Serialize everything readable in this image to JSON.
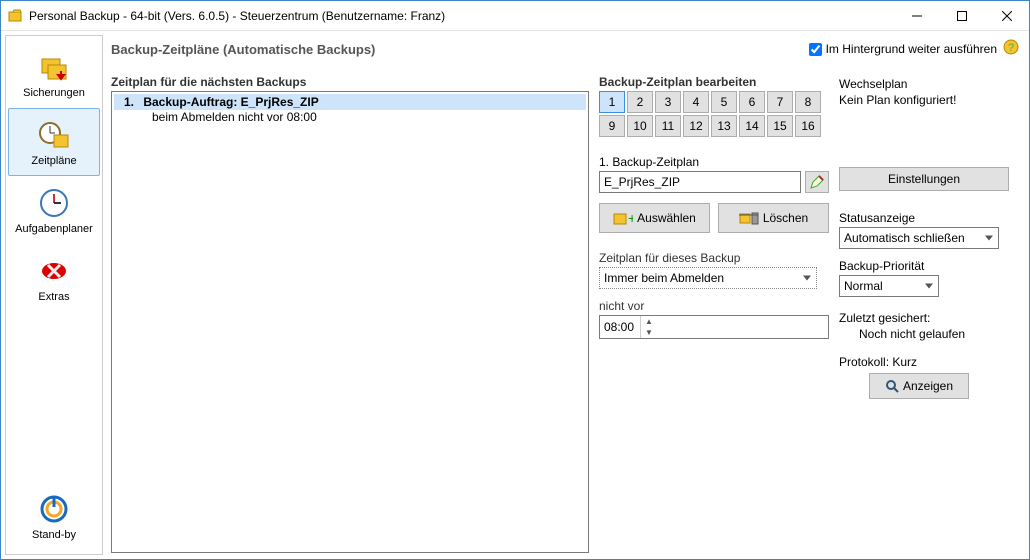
{
  "window": {
    "title": "Personal Backup - 64-bit (Vers. 6.0.5) - Steuerzentrum (Benutzername: Franz)"
  },
  "sidebar": {
    "items": [
      {
        "label": "Sicherungen"
      },
      {
        "label": "Zeitpläne"
      },
      {
        "label": "Aufgabenplaner"
      },
      {
        "label": "Extras"
      },
      {
        "label": "Stand-by"
      }
    ]
  },
  "header": {
    "title": "Backup-Zeitpläne (Automatische Backups)",
    "background_checkbox_label": "Im Hintergrund weiter ausführen",
    "background_checked": true
  },
  "left": {
    "heading": "Zeitplan für die nächsten Backups",
    "list": [
      {
        "idx": "1.",
        "title": "Backup-Auftrag: E_PrjRes_ZIP",
        "sub": "beim Abmelden nicht vor 08:00"
      }
    ]
  },
  "mid": {
    "heading": "Backup-Zeitplan bearbeiten",
    "slots": [
      "1",
      "2",
      "3",
      "4",
      "5",
      "6",
      "7",
      "8",
      "9",
      "10",
      "11",
      "12",
      "13",
      "14",
      "15",
      "16"
    ],
    "selected_slot": 0,
    "plan_prefix": "1.  Backup-Zeitplan",
    "plan_name": "E_PrjRes_ZIP",
    "btn_select": "Auswählen",
    "btn_delete": "Löschen",
    "sched_label": "Zeitplan für dieses Backup",
    "sched_value": "Immer beim Abmelden",
    "notbefore_label": "nicht vor",
    "notbefore_value": "08:00"
  },
  "right": {
    "wp_heading": "Wechselplan",
    "wp_status": "Kein Plan konfiguriert!",
    "btn_settings": "Einstellungen",
    "status_heading": "Statusanzeige",
    "status_value": "Automatisch schließen",
    "prio_heading": "Backup-Priorität",
    "prio_value": "Normal",
    "last_heading": "Zuletzt gesichert:",
    "last_value": "Noch nicht gelaufen",
    "log_heading": "Protokoll: Kurz",
    "btn_show": "Anzeigen"
  }
}
